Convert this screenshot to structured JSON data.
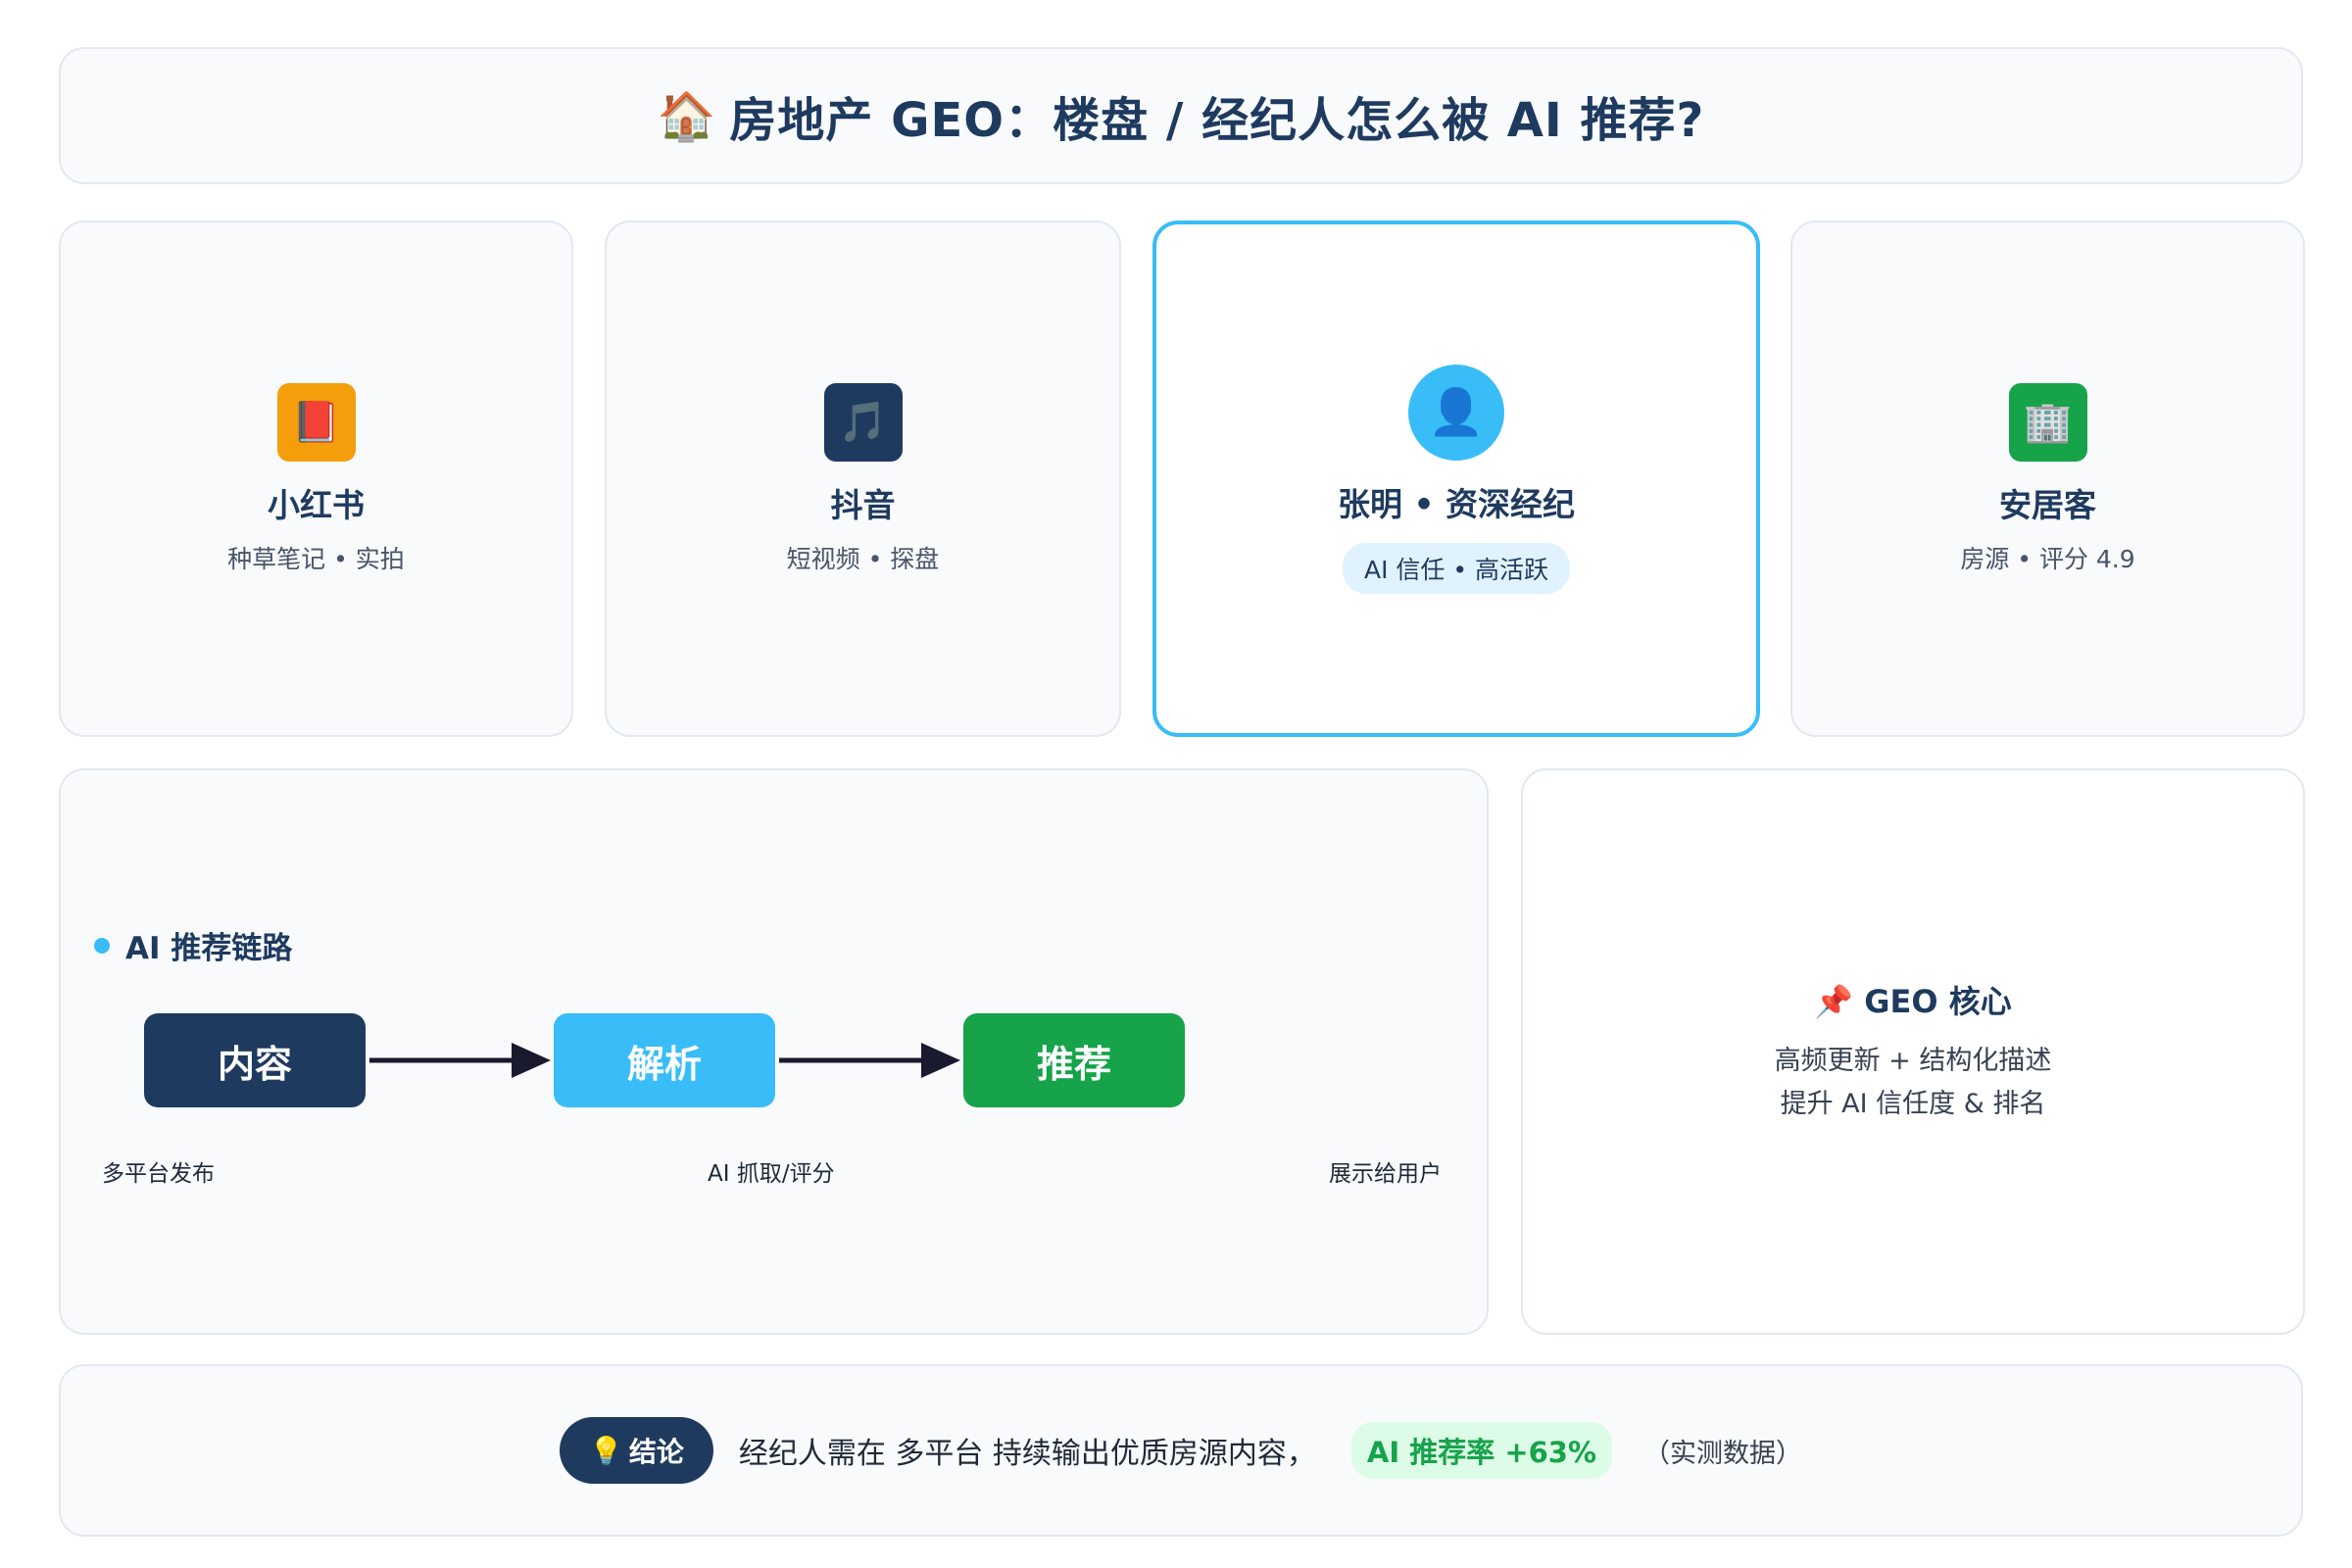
{
  "title": {
    "icon": "🏠",
    "text": "房地产 GEO：楼盘 / 经纪人怎么被 AI 推荐?"
  },
  "cards": [
    {
      "icon": "📕",
      "icon_bg": "#f59e0b",
      "name": "小红书",
      "sub": "种草笔记 • 实拍"
    },
    {
      "icon": "🎵",
      "icon_bg": "#1e3a5f",
      "name": "抖音",
      "sub": "短视频 • 探盘"
    },
    {
      "icon": "👤",
      "icon_bg": "#38bdf8",
      "name": "张明 • 资深经纪",
      "sub": "AI 信任 • 高活跃"
    },
    {
      "icon": "🏢",
      "icon_bg": "#16a34a",
      "name": "安居客",
      "sub": "房源 • 评分 4.9"
    }
  ],
  "chain": {
    "title": "AI 推荐链路",
    "steps": [
      {
        "label": "内容",
        "caption": "多平台发布"
      },
      {
        "label": "解析",
        "caption": "AI 抓取/评分"
      },
      {
        "label": "推荐",
        "caption": "展示给用户"
      }
    ]
  },
  "core": {
    "icon": "📌",
    "title": "GEO 核心",
    "lines": [
      "高频更新 + 结构化描述",
      "提升 AI 信任度 & 排名"
    ]
  },
  "conclusion": {
    "icon": "💡",
    "badge": "结论",
    "text": "经纪人需在 多平台 持续输出优质房源内容，",
    "rate": "AI 推荐率 +63%",
    "note": "（实测数据）"
  },
  "colors": {
    "navy": "#1e3a5f",
    "sky": "#38bdf8",
    "green": "#16a34a",
    "amber": "#f59e0b"
  }
}
